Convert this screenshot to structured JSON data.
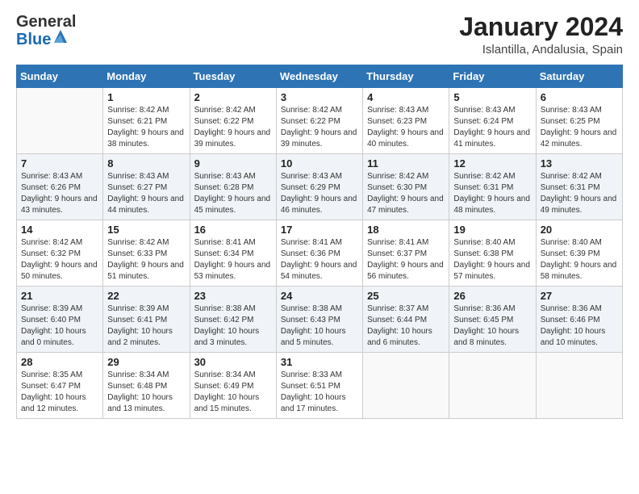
{
  "header": {
    "logo_general": "General",
    "logo_blue": "Blue",
    "month_title": "January 2024",
    "location": "Islantilla, Andalusia, Spain"
  },
  "days_of_week": [
    "Sunday",
    "Monday",
    "Tuesday",
    "Wednesday",
    "Thursday",
    "Friday",
    "Saturday"
  ],
  "weeks": [
    [
      {
        "day": "",
        "sunrise": "",
        "sunset": "",
        "daylight": ""
      },
      {
        "day": "1",
        "sunrise": "Sunrise: 8:42 AM",
        "sunset": "Sunset: 6:21 PM",
        "daylight": "Daylight: 9 hours and 38 minutes."
      },
      {
        "day": "2",
        "sunrise": "Sunrise: 8:42 AM",
        "sunset": "Sunset: 6:22 PM",
        "daylight": "Daylight: 9 hours and 39 minutes."
      },
      {
        "day": "3",
        "sunrise": "Sunrise: 8:42 AM",
        "sunset": "Sunset: 6:22 PM",
        "daylight": "Daylight: 9 hours and 39 minutes."
      },
      {
        "day": "4",
        "sunrise": "Sunrise: 8:43 AM",
        "sunset": "Sunset: 6:23 PM",
        "daylight": "Daylight: 9 hours and 40 minutes."
      },
      {
        "day": "5",
        "sunrise": "Sunrise: 8:43 AM",
        "sunset": "Sunset: 6:24 PM",
        "daylight": "Daylight: 9 hours and 41 minutes."
      },
      {
        "day": "6",
        "sunrise": "Sunrise: 8:43 AM",
        "sunset": "Sunset: 6:25 PM",
        "daylight": "Daylight: 9 hours and 42 minutes."
      }
    ],
    [
      {
        "day": "7",
        "sunrise": "Sunrise: 8:43 AM",
        "sunset": "Sunset: 6:26 PM",
        "daylight": "Daylight: 9 hours and 43 minutes."
      },
      {
        "day": "8",
        "sunrise": "Sunrise: 8:43 AM",
        "sunset": "Sunset: 6:27 PM",
        "daylight": "Daylight: 9 hours and 44 minutes."
      },
      {
        "day": "9",
        "sunrise": "Sunrise: 8:43 AM",
        "sunset": "Sunset: 6:28 PM",
        "daylight": "Daylight: 9 hours and 45 minutes."
      },
      {
        "day": "10",
        "sunrise": "Sunrise: 8:43 AM",
        "sunset": "Sunset: 6:29 PM",
        "daylight": "Daylight: 9 hours and 46 minutes."
      },
      {
        "day": "11",
        "sunrise": "Sunrise: 8:42 AM",
        "sunset": "Sunset: 6:30 PM",
        "daylight": "Daylight: 9 hours and 47 minutes."
      },
      {
        "day": "12",
        "sunrise": "Sunrise: 8:42 AM",
        "sunset": "Sunset: 6:31 PM",
        "daylight": "Daylight: 9 hours and 48 minutes."
      },
      {
        "day": "13",
        "sunrise": "Sunrise: 8:42 AM",
        "sunset": "Sunset: 6:31 PM",
        "daylight": "Daylight: 9 hours and 49 minutes."
      }
    ],
    [
      {
        "day": "14",
        "sunrise": "Sunrise: 8:42 AM",
        "sunset": "Sunset: 6:32 PM",
        "daylight": "Daylight: 9 hours and 50 minutes."
      },
      {
        "day": "15",
        "sunrise": "Sunrise: 8:42 AM",
        "sunset": "Sunset: 6:33 PM",
        "daylight": "Daylight: 9 hours and 51 minutes."
      },
      {
        "day": "16",
        "sunrise": "Sunrise: 8:41 AM",
        "sunset": "Sunset: 6:34 PM",
        "daylight": "Daylight: 9 hours and 53 minutes."
      },
      {
        "day": "17",
        "sunrise": "Sunrise: 8:41 AM",
        "sunset": "Sunset: 6:36 PM",
        "daylight": "Daylight: 9 hours and 54 minutes."
      },
      {
        "day": "18",
        "sunrise": "Sunrise: 8:41 AM",
        "sunset": "Sunset: 6:37 PM",
        "daylight": "Daylight: 9 hours and 56 minutes."
      },
      {
        "day": "19",
        "sunrise": "Sunrise: 8:40 AM",
        "sunset": "Sunset: 6:38 PM",
        "daylight": "Daylight: 9 hours and 57 minutes."
      },
      {
        "day": "20",
        "sunrise": "Sunrise: 8:40 AM",
        "sunset": "Sunset: 6:39 PM",
        "daylight": "Daylight: 9 hours and 58 minutes."
      }
    ],
    [
      {
        "day": "21",
        "sunrise": "Sunrise: 8:39 AM",
        "sunset": "Sunset: 6:40 PM",
        "daylight": "Daylight: 10 hours and 0 minutes."
      },
      {
        "day": "22",
        "sunrise": "Sunrise: 8:39 AM",
        "sunset": "Sunset: 6:41 PM",
        "daylight": "Daylight: 10 hours and 2 minutes."
      },
      {
        "day": "23",
        "sunrise": "Sunrise: 8:38 AM",
        "sunset": "Sunset: 6:42 PM",
        "daylight": "Daylight: 10 hours and 3 minutes."
      },
      {
        "day": "24",
        "sunrise": "Sunrise: 8:38 AM",
        "sunset": "Sunset: 6:43 PM",
        "daylight": "Daylight: 10 hours and 5 minutes."
      },
      {
        "day": "25",
        "sunrise": "Sunrise: 8:37 AM",
        "sunset": "Sunset: 6:44 PM",
        "daylight": "Daylight: 10 hours and 6 minutes."
      },
      {
        "day": "26",
        "sunrise": "Sunrise: 8:36 AM",
        "sunset": "Sunset: 6:45 PM",
        "daylight": "Daylight: 10 hours and 8 minutes."
      },
      {
        "day": "27",
        "sunrise": "Sunrise: 8:36 AM",
        "sunset": "Sunset: 6:46 PM",
        "daylight": "Daylight: 10 hours and 10 minutes."
      }
    ],
    [
      {
        "day": "28",
        "sunrise": "Sunrise: 8:35 AM",
        "sunset": "Sunset: 6:47 PM",
        "daylight": "Daylight: 10 hours and 12 minutes."
      },
      {
        "day": "29",
        "sunrise": "Sunrise: 8:34 AM",
        "sunset": "Sunset: 6:48 PM",
        "daylight": "Daylight: 10 hours and 13 minutes."
      },
      {
        "day": "30",
        "sunrise": "Sunrise: 8:34 AM",
        "sunset": "Sunset: 6:49 PM",
        "daylight": "Daylight: 10 hours and 15 minutes."
      },
      {
        "day": "31",
        "sunrise": "Sunrise: 8:33 AM",
        "sunset": "Sunset: 6:51 PM",
        "daylight": "Daylight: 10 hours and 17 minutes."
      },
      {
        "day": "",
        "sunrise": "",
        "sunset": "",
        "daylight": ""
      },
      {
        "day": "",
        "sunrise": "",
        "sunset": "",
        "daylight": ""
      },
      {
        "day": "",
        "sunrise": "",
        "sunset": "",
        "daylight": ""
      }
    ]
  ]
}
